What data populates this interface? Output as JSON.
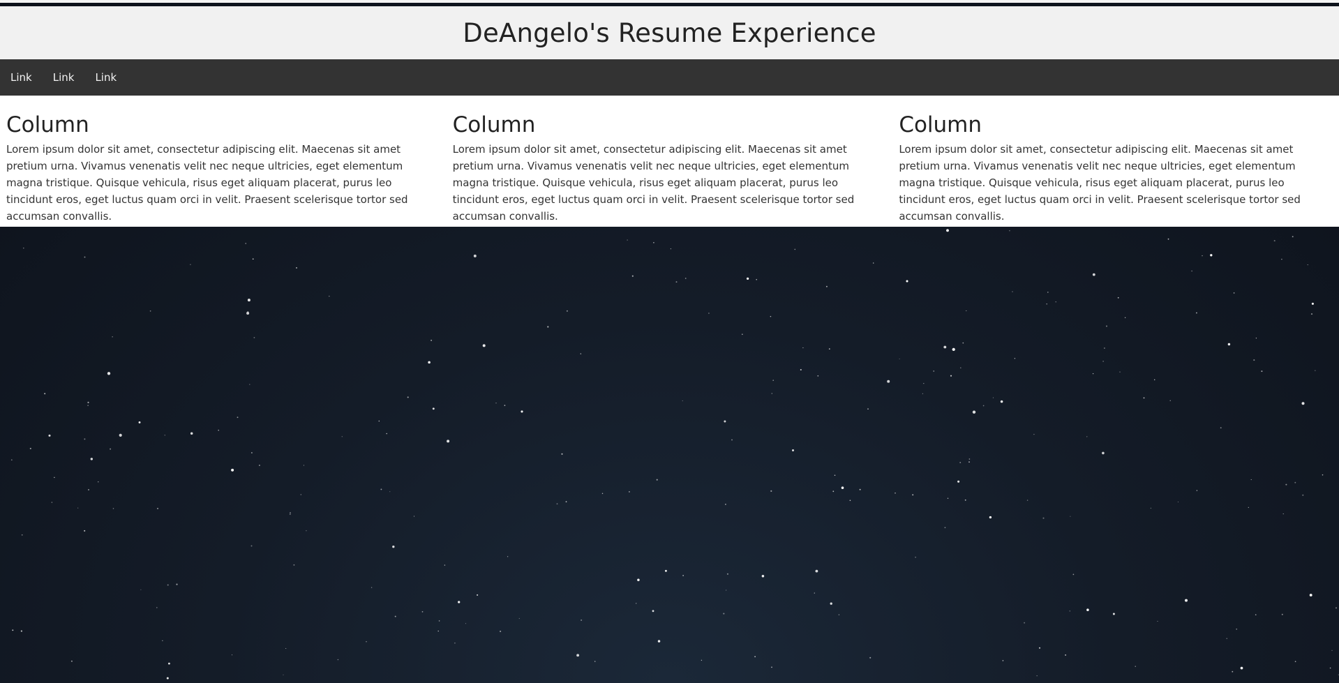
{
  "header": {
    "title": "DeAngelo's Resume Experience"
  },
  "nav": {
    "links": [
      "Link",
      "Link",
      "Link"
    ]
  },
  "columns": [
    {
      "heading": "Column",
      "text": "Lorem ipsum dolor sit amet, consectetur adipiscing elit. Maecenas sit amet pretium urna. Vivamus venenatis velit nec neque ultricies, eget elementum magna tristique. Quisque vehicula, risus eget aliquam placerat, purus leo tincidunt eros, eget luctus quam orci in velit. Praesent scelerisque tortor sed accumsan convallis."
    },
    {
      "heading": "Column",
      "text": "Lorem ipsum dolor sit amet, consectetur adipiscing elit. Maecenas sit amet pretium urna. Vivamus venenatis velit nec neque ultricies, eget elementum magna tristique. Quisque vehicula, risus eget aliquam placerat, purus leo tincidunt eros, eget luctus quam orci in velit. Praesent scelerisque tortor sed accumsan convallis."
    },
    {
      "heading": "Column",
      "text": "Lorem ipsum dolor sit amet, consectetur adipiscing elit. Maecenas sit amet pretium urna. Vivamus venenatis velit nec neque ultricies, eget elementum magna tristique. Quisque vehicula, risus eget aliquam placerat, purus leo tincidunt eros, eget luctus quam orci in velit. Praesent scelerisque tortor sed accumsan convallis."
    }
  ],
  "colors": {
    "header_bg": "#f1f1f1",
    "nav_bg": "#333333",
    "nav_text": "#f2f2f2",
    "content_bg": "#ffffff",
    "sky_center": "#1b2838",
    "sky_edge": "#0d121b"
  }
}
